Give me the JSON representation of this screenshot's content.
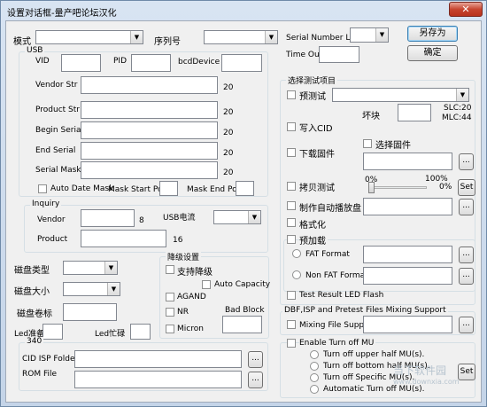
{
  "window": {
    "title": "设置对话框-量产吧论坛汉化",
    "close_glyph": "✕"
  },
  "top": {
    "mode_label": "模式",
    "serial_label": "序列号",
    "serial_number_len_label": "Serial Number Len",
    "timeout_label": "Time Out",
    "save_as_button": "另存为",
    "ok_button": "确定"
  },
  "usb": {
    "group_title": "USB",
    "vid_label": "VID",
    "pid_label": "PID",
    "bcd_label": "bcdDevice",
    "vendor_str_label": "Vendor Str",
    "vendor_str_len": "20",
    "product_str_label": "Product Str",
    "product_str_len": "20",
    "begin_serial_label": "Begin Serial",
    "begin_serial_len": "20",
    "end_serial_label": "End Serial",
    "end_serial_len": "20",
    "serial_mask_label": "Serial Mask",
    "serial_mask_len": "20",
    "auto_date_mask_label": "Auto Date Mask",
    "mask_start_pos_label": "Mask Start Pos",
    "mask_end_pos_label": "Mask End Pos"
  },
  "inquiry": {
    "group_title": "Inquiry",
    "vendor_label": "Vendor",
    "vendor_len": "8",
    "usb_current_label": "USB电流",
    "product_label": "Product",
    "product_len": "16"
  },
  "disk": {
    "type_label": "磁盘类型",
    "size_label": "磁盘大小",
    "volume_label": "磁盘卷标",
    "led_ready_label": "Led准备",
    "led_busy_label": "Led忙碌"
  },
  "downgrade": {
    "group_title": "降级设置",
    "support_label": "支持降级",
    "auto_capacity_label": "Auto Capacity",
    "agand_label": "AGAND",
    "nr_label": "NR",
    "bad_block_label": "Bad Block",
    "micron_label": "Micron"
  },
  "g340": {
    "group_title": "340",
    "cid_isp_label": "CID ISP Folder",
    "rom_file_label": "ROM File",
    "browse": "..."
  },
  "test": {
    "group_title": "选择测试项目",
    "pretest_label": "预测试",
    "bad_block_label": "坏块",
    "slc_text": "SLC:20",
    "mlc_text": "MLC:44",
    "write_cid_label": "写入CID",
    "download_fw_label": "下载固件",
    "select_fw_label": "选择固件",
    "copy_test_label": "拷贝测试",
    "pct_start": "0%",
    "pct_end": "100%",
    "pct_value": "0%",
    "set_button": "Set",
    "autoplay_label": "制作自动播放盘",
    "format_label": "格式化",
    "preload_label": "预加载",
    "fat_format_label": "FAT Format",
    "non_fat_format_label": "Non FAT Format",
    "led_flash_label": "Test Result LED Flash",
    "browse": "..."
  },
  "dbf": {
    "group_title": "DBF,ISP and Pretest Files Mixing Support",
    "mixing_file_label": "Mixing File Support",
    "browse": "..."
  },
  "turnoff": {
    "enable_label": "Enable Turn off MU",
    "upper_half_label": "Turn off upper half MU(s).",
    "bottom_half_label": "Turn off bottom half MU(s).",
    "specific_label": "Turn off Specific MU(s).",
    "auto_label": "Automatic Turn off MU(s).",
    "set_button": "Set"
  },
  "watermark": {
    "text": "当下软件园",
    "url": "www.downxia.com"
  },
  "icons": {
    "dropdown": "chevron-down-icon",
    "close": "close-icon"
  }
}
